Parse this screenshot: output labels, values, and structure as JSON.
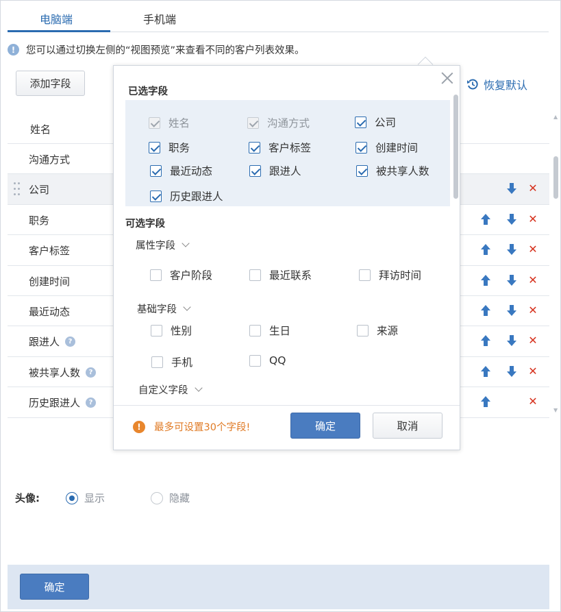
{
  "tabs": {
    "pc": "电脑端",
    "mobile": "手机端"
  },
  "info_text": "您可以通过切换左侧的“视图预览”来查看不同的客户列表效果。",
  "add_field_label": "添加字段",
  "restore_label": "恢复默认",
  "rows": [
    {
      "label": "姓名"
    },
    {
      "label": "沟通方式"
    },
    {
      "label": "公司"
    },
    {
      "label": "职务"
    },
    {
      "label": "客户标签"
    },
    {
      "label": "创建时间"
    },
    {
      "label": "最近动态"
    },
    {
      "label": "跟进人"
    },
    {
      "label": "被共享人数"
    },
    {
      "label": "历史跟进人"
    }
  ],
  "avatar": {
    "label": "头像:",
    "show": "显示",
    "hide": "隐藏",
    "selected": "显示"
  },
  "footer_ok": "确定",
  "modal": {
    "selected_title": "已选字段",
    "selected_fields": [
      {
        "label": "姓名",
        "checked": true,
        "disabled": true
      },
      {
        "label": "沟通方式",
        "checked": true,
        "disabled": true
      },
      {
        "label": "公司",
        "checked": true,
        "disabled": false
      },
      {
        "label": "职务",
        "checked": true,
        "disabled": false
      },
      {
        "label": "客户标签",
        "checked": true,
        "disabled": false
      },
      {
        "label": "创建时间",
        "checked": true,
        "disabled": false
      },
      {
        "label": "最近动态",
        "checked": true,
        "disabled": false
      },
      {
        "label": "跟进人",
        "checked": true,
        "disabled": false
      },
      {
        "label": "被共享人数",
        "checked": true,
        "disabled": false
      },
      {
        "label": "历史跟进人",
        "checked": true,
        "disabled": false
      }
    ],
    "optional_title": "可选字段",
    "groups": [
      {
        "title": "属性字段",
        "fields": [
          "客户阶段",
          "最近联系",
          "拜访时间"
        ]
      },
      {
        "title": "基础字段",
        "fields": [
          "性别",
          "生日",
          "来源",
          "手机",
          "QQ"
        ]
      },
      {
        "title": "自定义字段",
        "fields": []
      }
    ],
    "warning": "最多可设置30个字段!",
    "ok": "确定",
    "cancel": "取消"
  },
  "colors": {
    "accent": "#2a6bb0",
    "button": "#4a7cc0",
    "delete": "#d6321e",
    "warning": "#e07a24"
  }
}
